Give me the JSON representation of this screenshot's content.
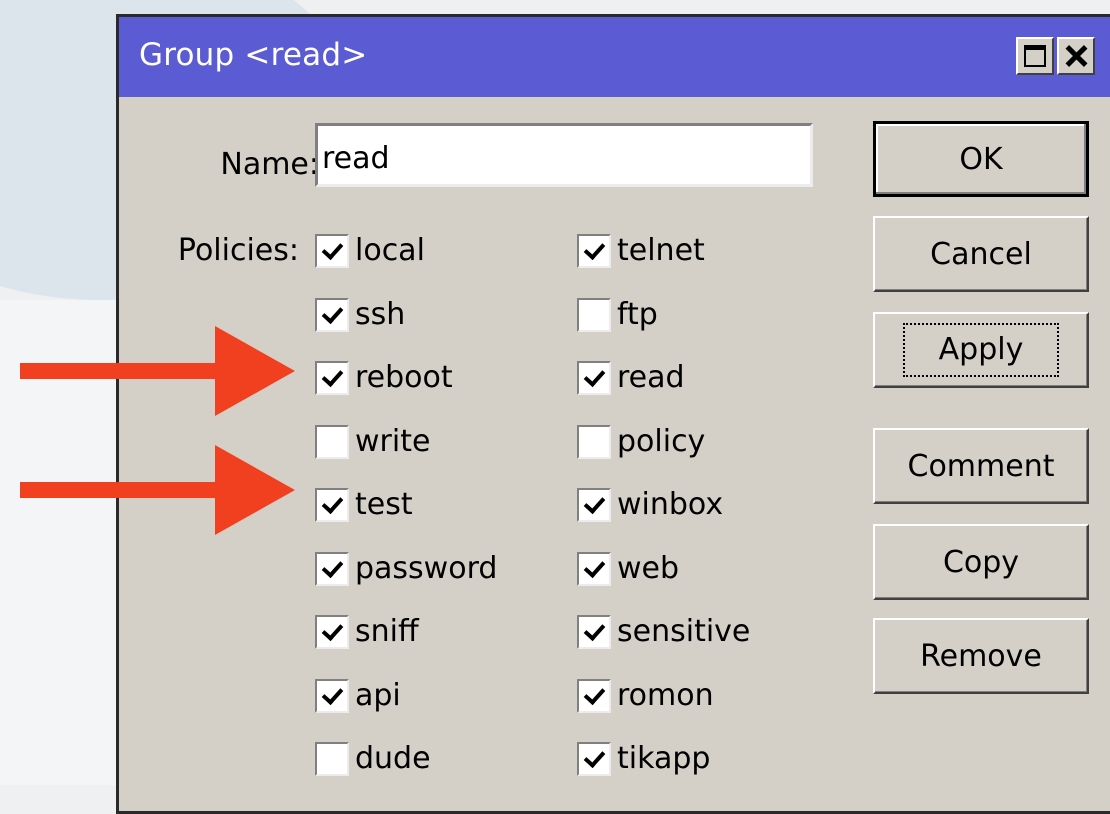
{
  "window": {
    "title": "Group <read>",
    "title_bar_color": "#5b5bd3",
    "controls": {
      "maximize_icon": "maximize-icon",
      "close_icon": "close-icon"
    }
  },
  "form": {
    "name_label": "Name:",
    "name_value": "read",
    "policies_label": "Policies:",
    "policies_left": [
      {
        "label": "local",
        "checked": true
      },
      {
        "label": "ssh",
        "checked": true
      },
      {
        "label": "reboot",
        "checked": true
      },
      {
        "label": "write",
        "checked": false
      },
      {
        "label": "test",
        "checked": true
      },
      {
        "label": "password",
        "checked": true
      },
      {
        "label": "sniff",
        "checked": true
      },
      {
        "label": "api",
        "checked": true
      },
      {
        "label": "dude",
        "checked": false
      }
    ],
    "policies_right": [
      {
        "label": "telnet",
        "checked": true
      },
      {
        "label": "ftp",
        "checked": false
      },
      {
        "label": "read",
        "checked": true
      },
      {
        "label": "policy",
        "checked": false
      },
      {
        "label": "winbox",
        "checked": true
      },
      {
        "label": "web",
        "checked": true
      },
      {
        "label": "sensitive",
        "checked": true
      },
      {
        "label": "romon",
        "checked": true
      },
      {
        "label": "tikapp",
        "checked": true
      }
    ]
  },
  "buttons": {
    "ok": "OK",
    "cancel": "Cancel",
    "apply": "Apply",
    "comment": "Comment",
    "copy": "Copy",
    "remove": "Remove"
  },
  "annotations": {
    "arrow_color": "#f0401f",
    "arrows_point_to": [
      "reboot",
      "test"
    ]
  }
}
